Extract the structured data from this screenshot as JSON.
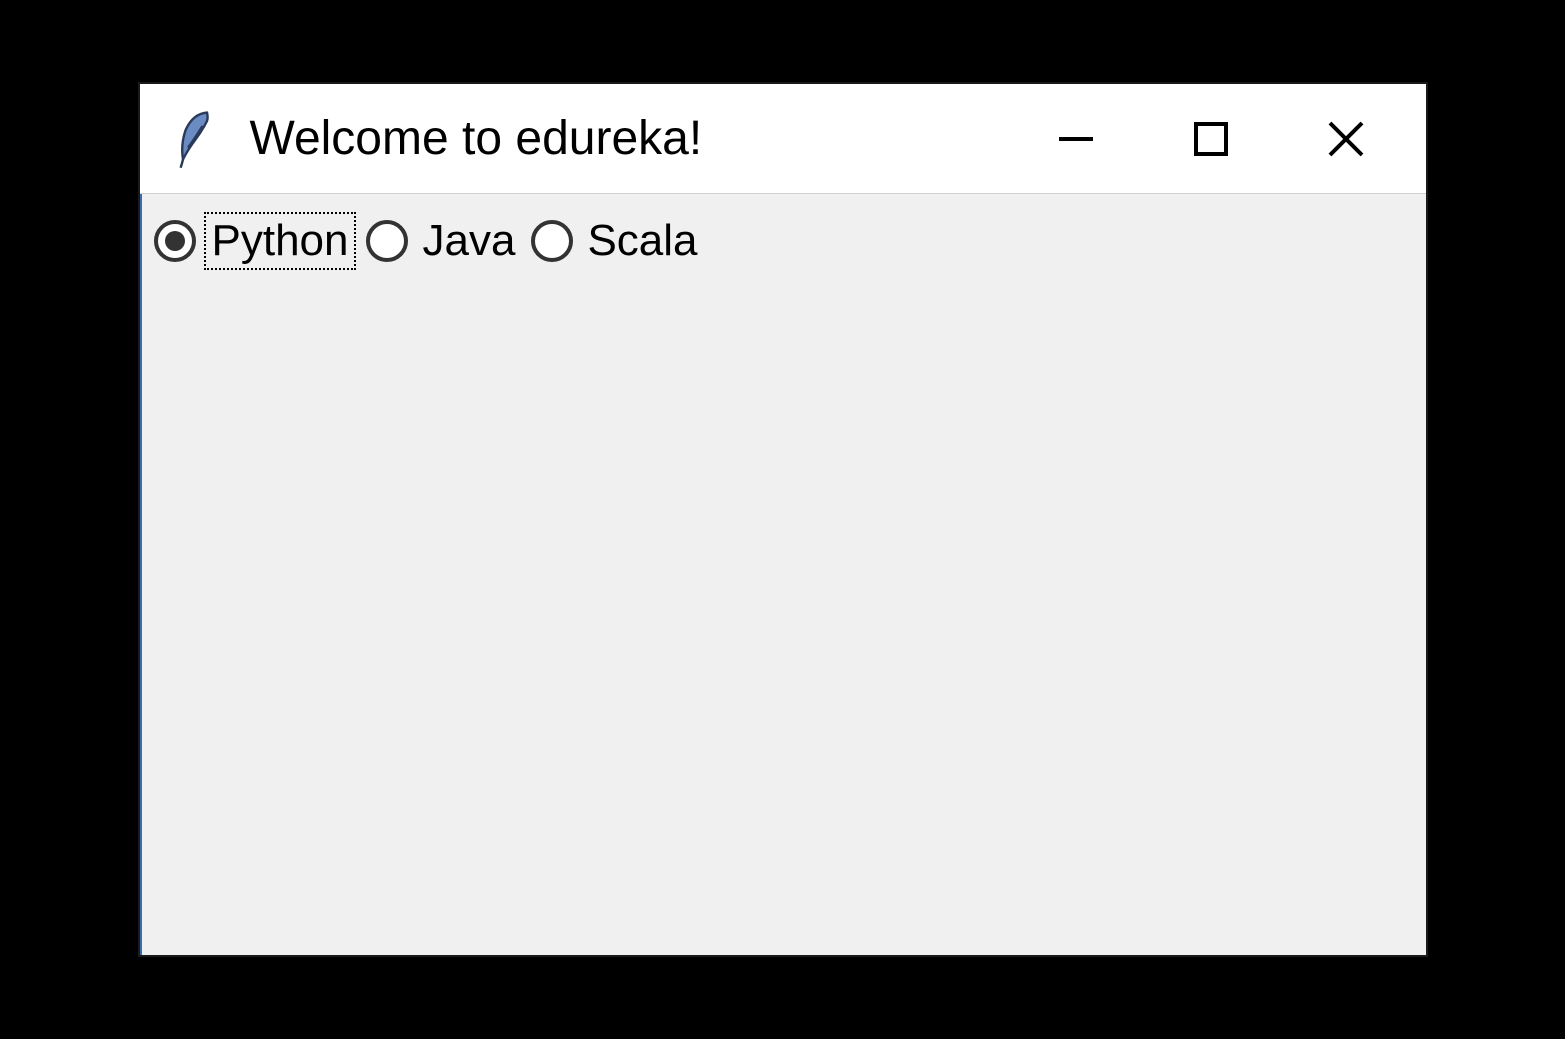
{
  "window": {
    "title": "Welcome to edureka!"
  },
  "radios": [
    {
      "label": "Python",
      "selected": true,
      "focused": true
    },
    {
      "label": "Java",
      "selected": false,
      "focused": false
    },
    {
      "label": "Scala",
      "selected": false,
      "focused": false
    }
  ]
}
